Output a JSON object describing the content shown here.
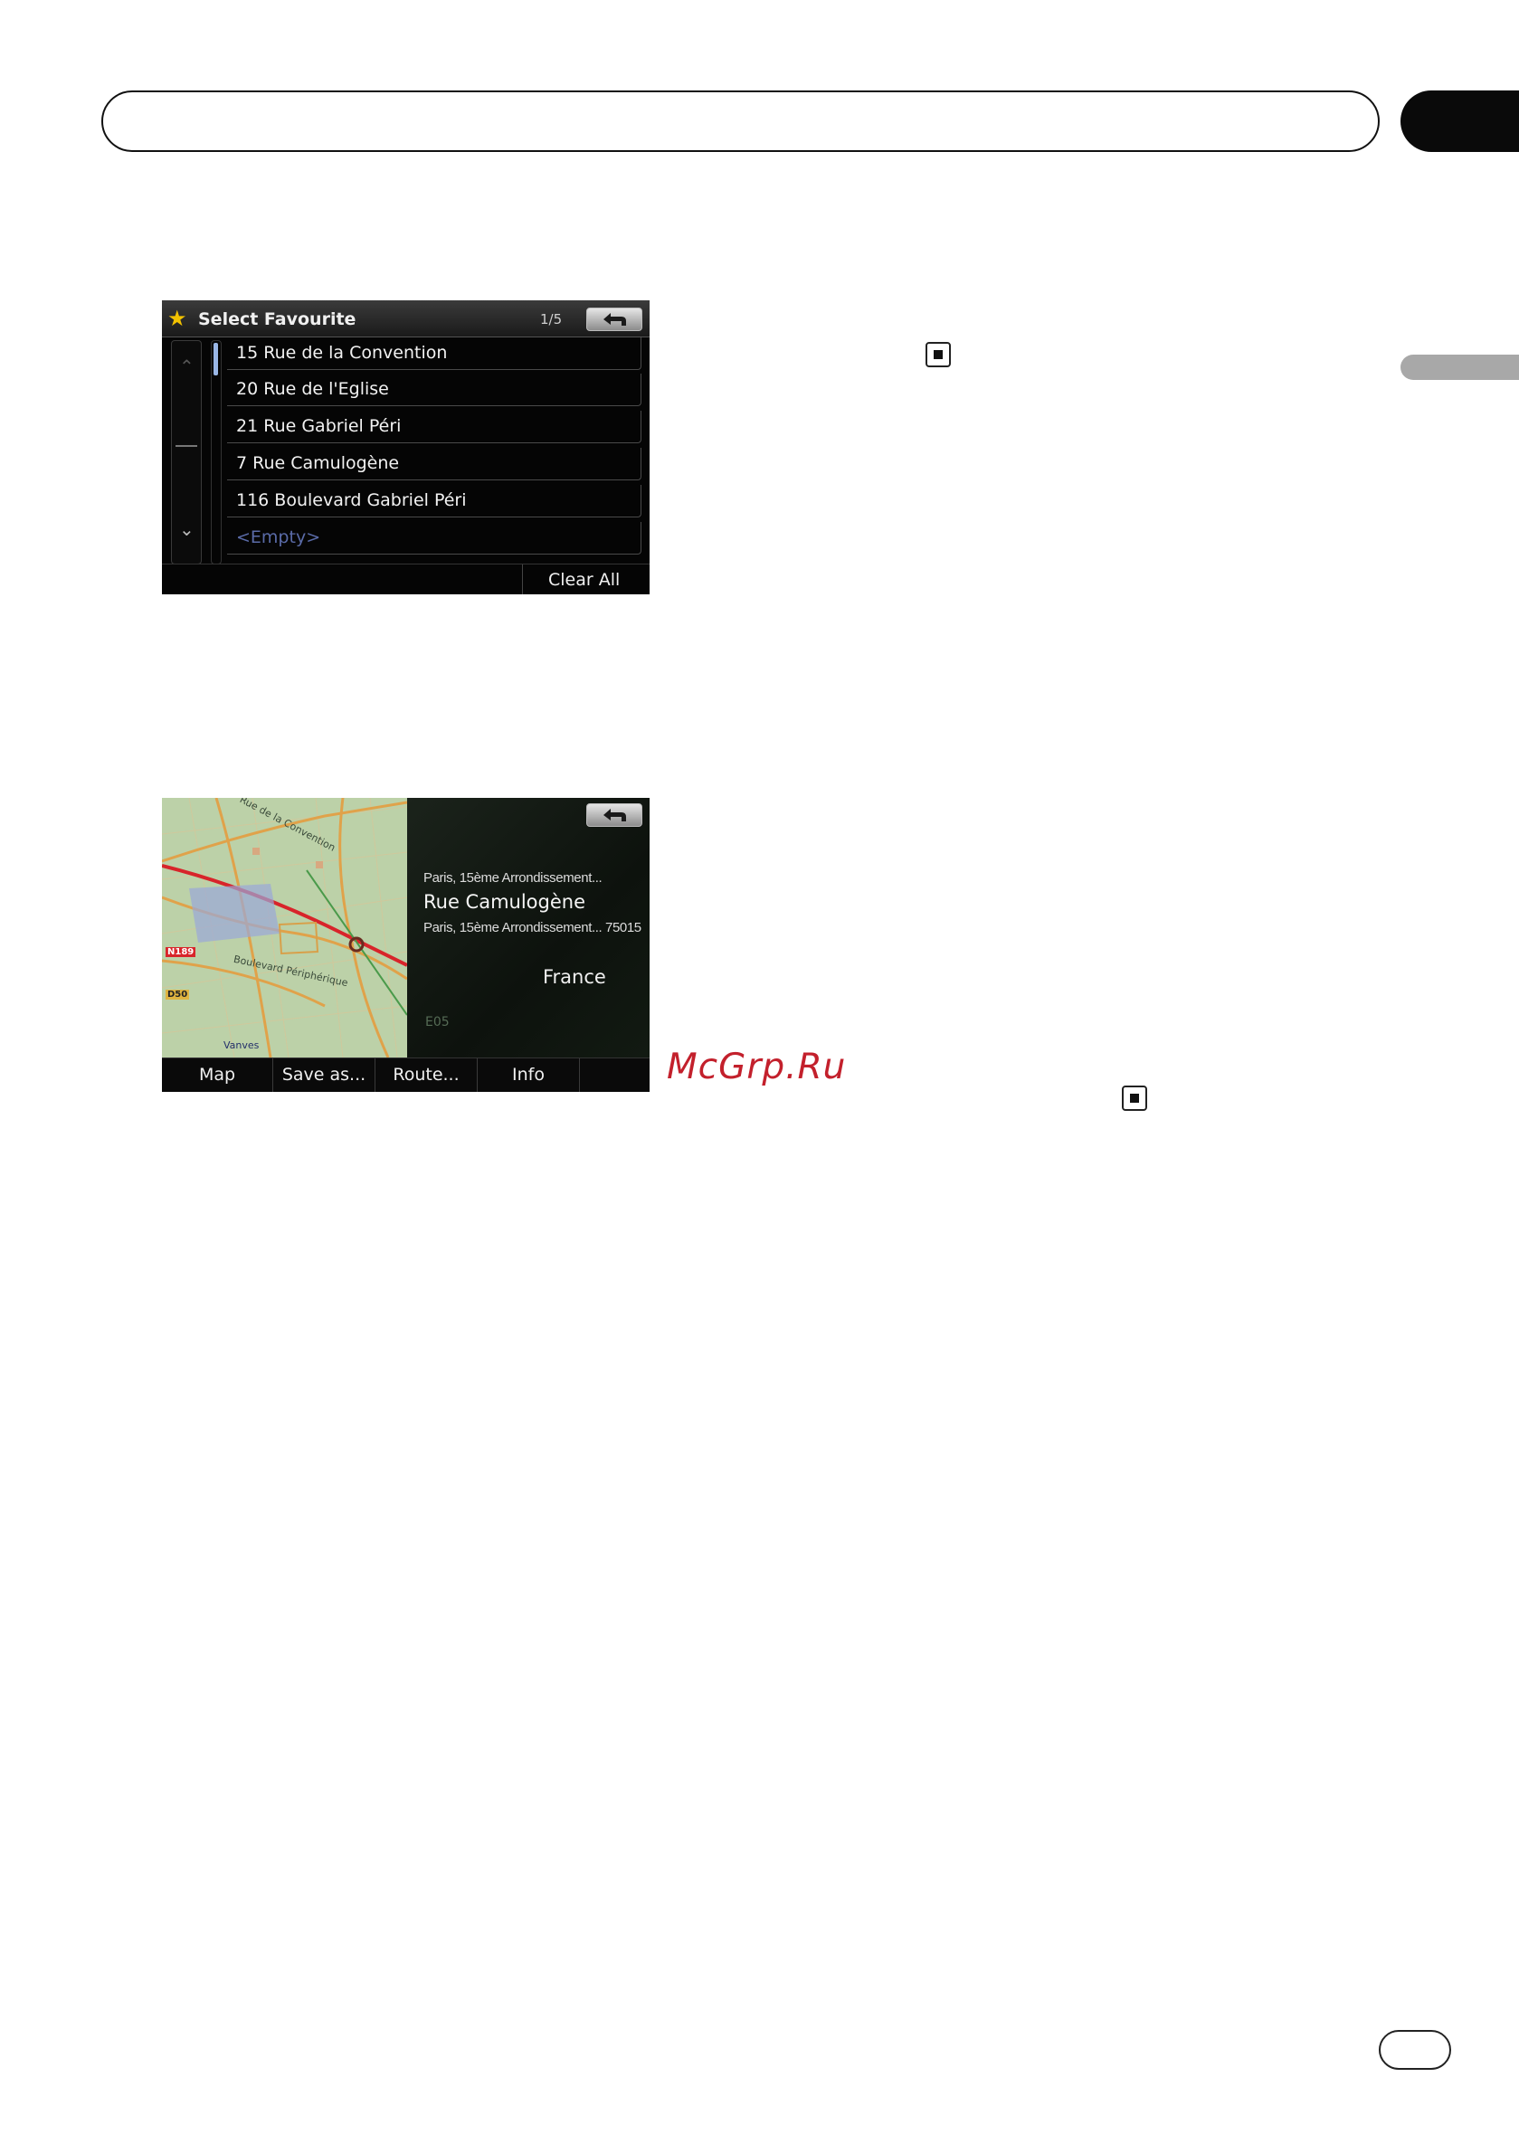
{
  "watermark": "McGrp.Ru",
  "screen1": {
    "title": "Select Favourite",
    "page_indicator": "1/5",
    "items": [
      "15 Rue de la Convention",
      "20 Rue de l'Eglise",
      "21 Rue Gabriel Péri",
      "7 Rue Camulogène",
      "116 Boulevard Gabriel Péri",
      "<Empty>"
    ],
    "clear_all_label": "Clear All"
  },
  "screen2": {
    "info": {
      "line1": "Paris, 15ème Arrondissement...",
      "street": "Rue Camulogène",
      "line3": "Paris, 15ème Arrondissement... 75015",
      "country": "France"
    },
    "map_labels": {
      "road_e05": "E05",
      "road_d50": "D50",
      "road_n": "N189",
      "street1": "Boulevard Périphérique",
      "street2": "Rue de la Convention",
      "town": "Vanves"
    },
    "toolbar": {
      "map_label": "Map",
      "save_label": "Save as...",
      "route_label": "Route...",
      "info_label": "Info"
    }
  }
}
